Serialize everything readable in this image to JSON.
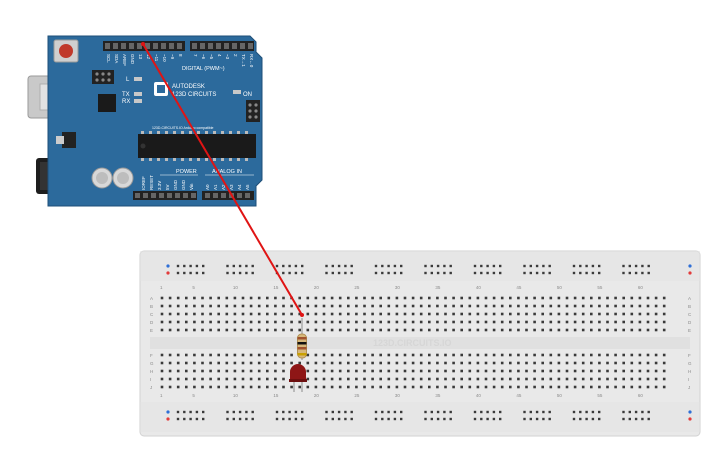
{
  "board": {
    "header_labels": [
      "SCL",
      "SDA",
      "AREF",
      "GND",
      "13",
      "12",
      "~11",
      "~10",
      "~9",
      "8",
      "7",
      "~6",
      "~5",
      "4",
      "~3",
      "2",
      "TX→1",
      "RX←0"
    ],
    "digital_label": "DIGITAL (PWM~)",
    "led_label": "L",
    "tx_label": "TX",
    "rx_label": "RX",
    "brand_line1": "AUTODESK",
    "brand_line2": "123D CIRCUITS",
    "on_label": "ON",
    "fine_print": "123D-CIRCUITS.IO Arduino compatible",
    "power_label": "POWER",
    "analog_label": "ANALOG IN",
    "power_pins": [
      "IOREF",
      "RESET",
      "3.3V",
      "5V",
      "GND",
      "GND",
      "Vin"
    ],
    "analog_pins": [
      "A0",
      "A1",
      "A2",
      "A3",
      "A4",
      "A5"
    ],
    "color_board": "#2c6a9c",
    "color_wire": "#e01414"
  },
  "breadboard": {
    "watermark": "123D.CIRCUITS.IO",
    "column_numbers": [
      "1",
      "5",
      "10",
      "15",
      "20",
      "25",
      "30",
      "35",
      "40",
      "45",
      "50",
      "55",
      "60"
    ],
    "row_letters_top": [
      "A",
      "B",
      "C",
      "D",
      "E"
    ],
    "row_letters_bottom": [
      "F",
      "G",
      "H",
      "I",
      "J"
    ],
    "color_body": "#e9e9e9"
  },
  "components": {
    "resistor_band_colors": [
      "#a0522d",
      "#111111",
      "#a0522d",
      "#c9a000"
    ],
    "led_color": "#8e1616"
  }
}
